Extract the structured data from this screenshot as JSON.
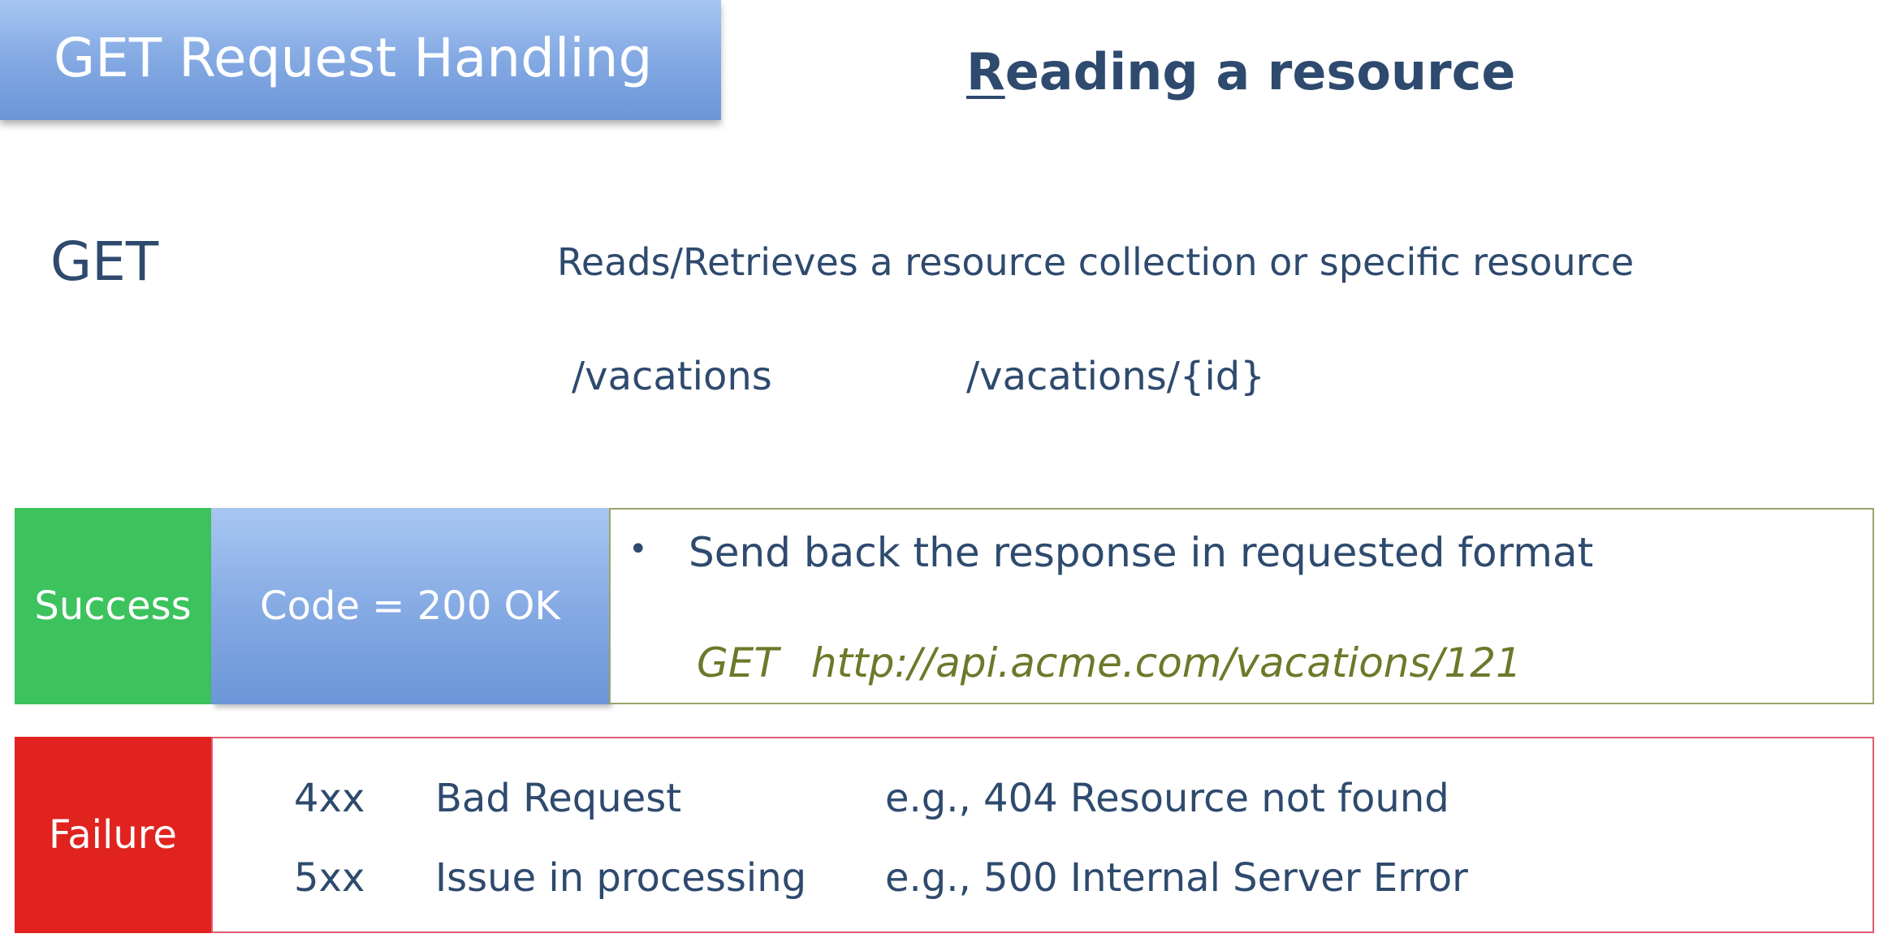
{
  "title": "GET Request Handling",
  "subtitle": {
    "first_letter": "R",
    "rest": "eading a resource"
  },
  "method": "GET",
  "description": "Reads/Retrieves  a resource collection or specific resource",
  "paths": [
    "/vacations",
    "/vacations/{id}"
  ],
  "success": {
    "label": "Success",
    "code": "Code = 200 OK",
    "bullet": "•",
    "bullet_text": "Send back the response in requested format",
    "example_method": "GET",
    "example_url": "http://api.acme.com/vacations/121"
  },
  "failure": {
    "label": "Failure",
    "rows": [
      {
        "code": "4xx",
        "name": "Bad Request",
        "example": "e.g., 404 Resource not found"
      },
      {
        "code": "5xx",
        "name": "Issue in processing",
        "example": "e.g., 500 Internal Server Error"
      }
    ]
  },
  "colors": {
    "banner_blue": "#86abe4",
    "text_navy": "#2e4a6e",
    "success_green": "#3cc35d",
    "failure_red": "#e0231f",
    "example_olive": "#6a7a2a"
  }
}
